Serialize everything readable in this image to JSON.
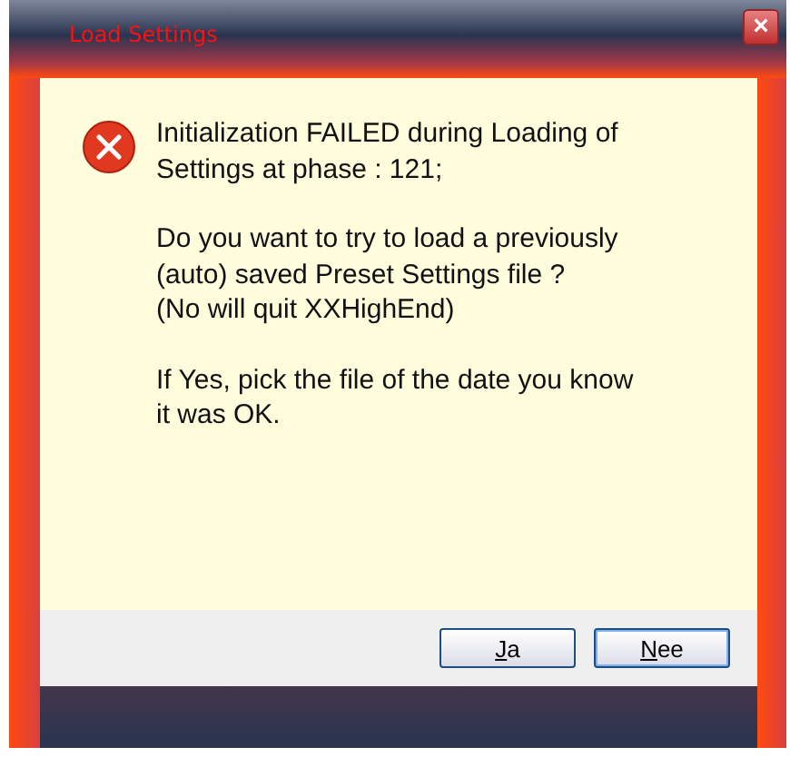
{
  "window": {
    "title": "Load Settings",
    "close": "×"
  },
  "message": [
    "Initialization FAILED during Loading of Settings at phase : 121;",
    "Do you want to try to load a previously (auto) saved Preset Settings file ?\n(No will quit XXHighEnd)",
    "If Yes, pick the file of the date you know it was OK."
  ],
  "buttons": [
    {
      "label": "Ja",
      "default": false
    },
    {
      "label": "Nee",
      "default": true
    }
  ]
}
